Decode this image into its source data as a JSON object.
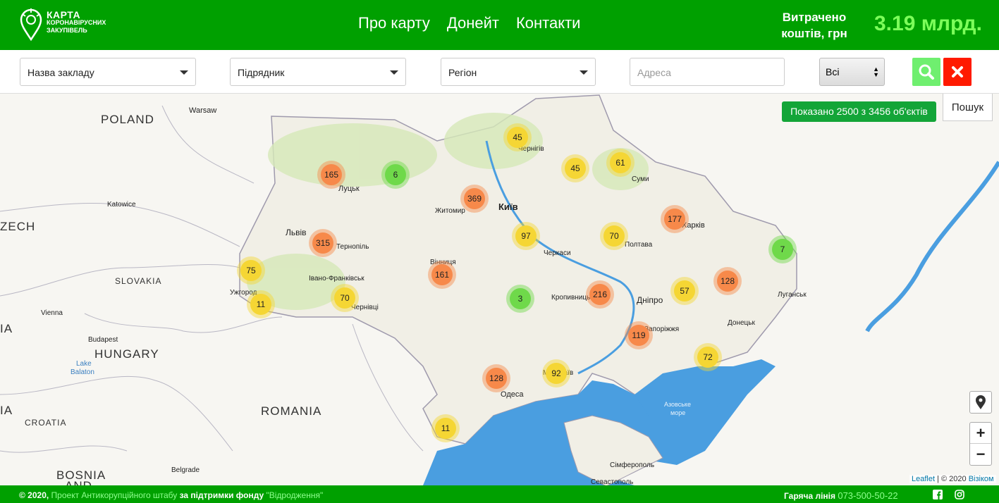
{
  "header": {
    "logo_line1": "КАРТА",
    "logo_line2": "КОРОНАВІРУСНИХ",
    "logo_line3": "ЗАКУПІВЕЛЬ",
    "nav": [
      "Про карту",
      "Донейт",
      "Контакти"
    ],
    "spent_label_1": "Витрачено",
    "spent_label_2": "коштів, грн",
    "spent_value": "3.19 млрд."
  },
  "filters": {
    "institution": "Назва закладу",
    "contractor": "Підрядник",
    "region": "Регіон",
    "address_placeholder": "Адреса",
    "status": "Всі"
  },
  "map": {
    "shown_badge": "Показано 2500 з 3456 об'єктів",
    "search_button": "Пошук",
    "zoom_in": "+",
    "zoom_out": "−",
    "attribution_leaflet": "Leaflet",
    "attribution_rest": " | © 2020 ",
    "attribution_visicom": "Візіком",
    "countries": [
      "POLAND",
      "ZECH",
      "SLOVAKIA",
      "HUNGARY",
      "ROMANIA",
      "CROATIA",
      "BOSNIA",
      "AND",
      "IA",
      "IA"
    ],
    "cities": [
      "Warsaw",
      "Katowice",
      "Vienna",
      "Budapest",
      "Lake",
      "Balaton",
      "Belgrade",
      "Луцьк",
      "Львів",
      "Тернопіль",
      "Івано-Франківськ",
      "Ужгород",
      "Чернівці",
      "Житомир",
      "Київ",
      "Чернігів",
      "Суми",
      "Харків",
      "Полтава",
      "Черкаси",
      "Вінниця",
      "Кропивницький",
      "Дніпро",
      "Запоріжжя",
      "Донецьк",
      "Луганськ",
      "Миколаїв",
      "Одеса",
      "Сімферополь",
      "Севастополь",
      "Азовське",
      "море"
    ],
    "clusters": [
      {
        "value": "45",
        "level": "yellow"
      },
      {
        "value": "165",
        "level": "orange"
      },
      {
        "value": "6",
        "level": "green"
      },
      {
        "value": "45",
        "level": "yellow"
      },
      {
        "value": "61",
        "level": "yellow"
      },
      {
        "value": "369",
        "level": "orange"
      },
      {
        "value": "177",
        "level": "orange"
      },
      {
        "value": "315",
        "level": "orange"
      },
      {
        "value": "97",
        "level": "yellow"
      },
      {
        "value": "70",
        "level": "yellow"
      },
      {
        "value": "7",
        "level": "green"
      },
      {
        "value": "75",
        "level": "yellow"
      },
      {
        "value": "161",
        "level": "orange"
      },
      {
        "value": "128",
        "level": "orange"
      },
      {
        "value": "57",
        "level": "yellow"
      },
      {
        "value": "216",
        "level": "orange"
      },
      {
        "value": "11",
        "level": "yellow"
      },
      {
        "value": "70",
        "level": "yellow"
      },
      {
        "value": "3",
        "level": "green"
      },
      {
        "value": "119",
        "level": "orange"
      },
      {
        "value": "72",
        "level": "yellow"
      },
      {
        "value": "128",
        "level": "orange"
      },
      {
        "value": "92",
        "level": "yellow"
      },
      {
        "value": "11",
        "level": "yellow"
      }
    ]
  },
  "footer": {
    "copyright": "© 2020, ",
    "project_link": "Проект Антикорупційного штабу",
    "support_text": " за підтримки фонду ",
    "fund_link": "\"Відродження\"",
    "hotline_label": "Гаряча лінія ",
    "hotline_number": "073-500-50-22"
  },
  "colors": {
    "header": "#00a000",
    "accent": "#7dff5a",
    "green": "#6fd94a",
    "yellow": "#f5d634",
    "orange": "#f7894a",
    "sea": "#4a9ee0"
  }
}
